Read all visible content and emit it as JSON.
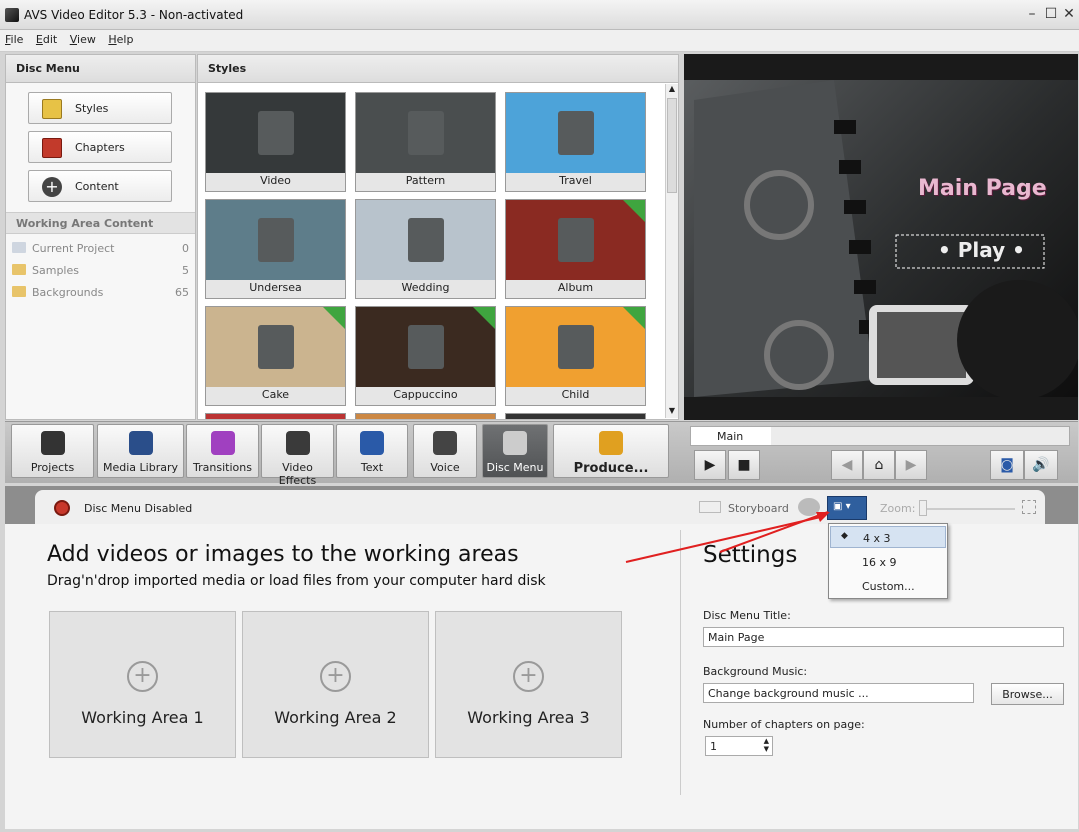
{
  "window": {
    "title": "AVS Video Editor 5.3 - Non-activated",
    "controls": [
      "–",
      "☐",
      "✕"
    ]
  },
  "menu": [
    "File",
    "Edit",
    "View",
    "Help"
  ],
  "disc_panel": {
    "header": "Disc Menu",
    "buttons": [
      {
        "label": "Styles",
        "icon": "styles-icon",
        "color": "#e7c246"
      },
      {
        "label": "Chapters",
        "icon": "chapters-icon",
        "color": "#c23a2b"
      },
      {
        "label": "Content",
        "icon": "content-plus-icon",
        "color": "#444444"
      }
    ],
    "working_area_header": "Working Area Content",
    "working_area_items": [
      {
        "name": "Current Project",
        "count": "0"
      },
      {
        "name": "Samples",
        "count": "5"
      },
      {
        "name": "Backgrounds",
        "count": "65"
      }
    ]
  },
  "styles_panel": {
    "header": "Styles",
    "tiles": [
      {
        "label": "Video",
        "badge": false,
        "color": "#35393a"
      },
      {
        "label": "Pattern",
        "badge": false,
        "color": "#4a4e4f"
      },
      {
        "label": "Travel",
        "badge": false,
        "color": "#4da3d9"
      },
      {
        "label": "Undersea",
        "badge": false,
        "color": "#5e7d8a"
      },
      {
        "label": "Wedding",
        "badge": false,
        "color": "#b8c3cc"
      },
      {
        "label": "Album",
        "badge": true,
        "color": "#8a2a22"
      },
      {
        "label": "Cake",
        "badge": true,
        "color": "#cbb48f"
      },
      {
        "label": "Cappuccino",
        "badge": true,
        "color": "#3b2a20"
      },
      {
        "label": "Child",
        "badge": true,
        "color": "#f0a030"
      }
    ]
  },
  "preview": {
    "title": "Main Page",
    "play": "• Play •"
  },
  "toolbar": {
    "buttons": [
      {
        "label": "Projects",
        "icon": "clapperboard-icon"
      },
      {
        "label": "Media Library",
        "icon": "film-icon"
      },
      {
        "label": "Transitions",
        "icon": "transitions-icon"
      },
      {
        "label": "Video Effects",
        "icon": "video-effects-icon"
      },
      {
        "label": "Text",
        "icon": "text-icon"
      },
      {
        "label": "Voice",
        "icon": "microphone-icon"
      },
      {
        "label": "Disc Menu",
        "icon": "disc-menu-icon"
      },
      {
        "label": "Produce...",
        "icon": "produce-icon"
      }
    ],
    "track_label": "Main"
  },
  "lower": {
    "disc_menu_status": "Disc Menu Disabled",
    "storyboard": "Storyboard",
    "zoom_label": "Zoom:",
    "heading": "Add videos or images to the working areas",
    "subheading": "Drag'n'drop imported media or load files from your computer hard disk",
    "working_areas": [
      "Working Area 1",
      "Working Area 2",
      "Working Area 3"
    ],
    "settings": {
      "title": "Settings",
      "disc_title_label": "Disc Menu Title:",
      "disc_title_value": "Main Page",
      "bg_music_label": "Background Music:",
      "bg_music_value": "Change background music ...",
      "browse": "Browse...",
      "chapters_label": "Number of chapters on page:",
      "chapters_value": "1"
    },
    "aspect_dropdown": {
      "options": [
        "4 x 3",
        "16 x 9",
        "Custom..."
      ],
      "selected": "4 x 3"
    }
  }
}
